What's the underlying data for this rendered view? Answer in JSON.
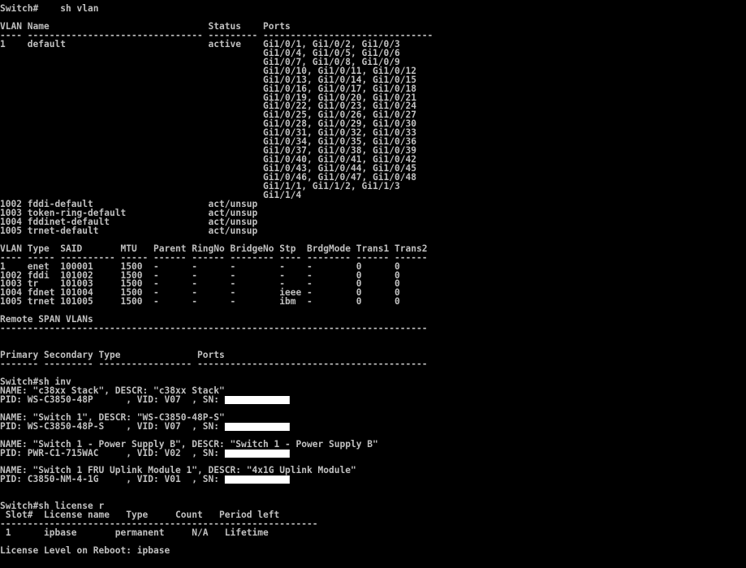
{
  "terminal": {
    "foreground": "#c0c0c0",
    "background": "#000000",
    "redaction_color": "#ffffff",
    "lines": [
      {
        "text": "Switch#    sh vlan"
      },
      {
        "text": ""
      },
      {
        "text": "VLAN Name                             Status    Ports"
      },
      {
        "text": "---- -------------------------------- --------- -------------------------------"
      },
      {
        "text": "1    default                          active    Gi1/0/1, Gi1/0/2, Gi1/0/3"
      },
      {
        "text": "                                                Gi1/0/4, Gi1/0/5, Gi1/0/6"
      },
      {
        "text": "                                                Gi1/0/7, Gi1/0/8, Gi1/0/9"
      },
      {
        "text": "                                                Gi1/0/10, Gi1/0/11, Gi1/0/12"
      },
      {
        "text": "                                                Gi1/0/13, Gi1/0/14, Gi1/0/15"
      },
      {
        "text": "                                                Gi1/0/16, Gi1/0/17, Gi1/0/18"
      },
      {
        "text": "                                                Gi1/0/19, Gi1/0/20, Gi1/0/21"
      },
      {
        "text": "                                                Gi1/0/22, Gi1/0/23, Gi1/0/24"
      },
      {
        "text": "                                                Gi1/0/25, Gi1/0/26, Gi1/0/27"
      },
      {
        "text": "                                                Gi1/0/28, Gi1/0/29, Gi1/0/30"
      },
      {
        "text": "                                                Gi1/0/31, Gi1/0/32, Gi1/0/33"
      },
      {
        "text": "                                                Gi1/0/34, Gi1/0/35, Gi1/0/36"
      },
      {
        "text": "                                                Gi1/0/37, Gi1/0/38, Gi1/0/39"
      },
      {
        "text": "                                                Gi1/0/40, Gi1/0/41, Gi1/0/42"
      },
      {
        "text": "                                                Gi1/0/43, Gi1/0/44, Gi1/0/45"
      },
      {
        "text": "                                                Gi1/0/46, Gi1/0/47, Gi1/0/48"
      },
      {
        "text": "                                                Gi1/1/1, Gi1/1/2, Gi1/1/3"
      },
      {
        "text": "                                                Gi1/1/4"
      },
      {
        "text": "1002 fddi-default                     act/unsup"
      },
      {
        "text": "1003 token-ring-default               act/unsup"
      },
      {
        "text": "1004 fddinet-default                  act/unsup"
      },
      {
        "text": "1005 trnet-default                    act/unsup"
      },
      {
        "text": ""
      },
      {
        "text": "VLAN Type  SAID       MTU   Parent RingNo BridgeNo Stp  BrdgMode Trans1 Trans2"
      },
      {
        "text": "---- ----- ---------- ----- ------ ------ -------- ---- -------- ------ ------"
      },
      {
        "text": "1    enet  100001     1500  -      -      -        -    -        0      0"
      },
      {
        "text": "1002 fddi  101002     1500  -      -      -        -    -        0      0"
      },
      {
        "text": "1003 tr    101003     1500  -      -      -        -    -        0      0"
      },
      {
        "text": "1004 fdnet 101004     1500  -      -      -        ieee -        0      0"
      },
      {
        "text": "1005 trnet 101005     1500  -      -      -        ibm  -        0      0"
      },
      {
        "text": ""
      },
      {
        "text": "Remote SPAN VLANs"
      },
      {
        "text": "------------------------------------------------------------------------------"
      },
      {
        "text": ""
      },
      {
        "text": ""
      },
      {
        "text": "Primary Secondary Type              Ports"
      },
      {
        "text": "------- --------- ----------------- ------------------------------------------"
      },
      {
        "text": ""
      },
      {
        "text": "Switch#sh inv"
      },
      {
        "text": "NAME: \"c38xx Stack\", DESCR: \"c38xx Stack\""
      },
      {
        "text": "PID: WS-C3850-48P      , VID: V07  , SN: ",
        "redacted": true
      },
      {
        "text": ""
      },
      {
        "text": "NAME: \"Switch 1\", DESCR: \"WS-C3850-48P-S\""
      },
      {
        "text": "PID: WS-C3850-48P-S    , VID: V07  , SN: ",
        "redacted": true
      },
      {
        "text": ""
      },
      {
        "text": "NAME: \"Switch 1 - Power Supply B\", DESCR: \"Switch 1 - Power Supply B\""
      },
      {
        "text": "PID: PWR-C1-715WAC     , VID: V02  , SN: ",
        "redacted": true
      },
      {
        "text": ""
      },
      {
        "text": "NAME: \"Switch 1 FRU Uplink Module 1\", DESCR: \"4x1G Uplink Module\""
      },
      {
        "text": "PID: C3850-NM-4-1G     , VID: V01  , SN: ",
        "redacted": true
      },
      {
        "text": ""
      },
      {
        "text": ""
      },
      {
        "text": "Switch#sh license r"
      },
      {
        "text": " Slot#  License name   Type     Count   Period left"
      },
      {
        "text": "----------------------------------------------------------"
      },
      {
        "text": " 1      ipbase       permanent     N/A   Lifetime"
      },
      {
        "text": ""
      },
      {
        "text": "License Level on Reboot: ipbase"
      }
    ]
  }
}
